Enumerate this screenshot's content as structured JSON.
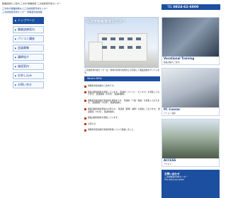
{
  "header": {
    "intro": "職業訓練のご案内 三次市 職業訓練 三次技能者育成センター",
    "link1": "三次市の職業訓練なら三次技能者育成センター",
    "link2": "三次技能者育成センター 求職者支援訓練",
    "tel_label": "TEL",
    "tel_number": "0824-62-6000"
  },
  "sidebar": {
    "items": [
      {
        "label": "トップページ",
        "active": true
      },
      {
        "label": "職業訓練案内",
        "active": false
      },
      {
        "label": "パソコン講座",
        "active": false
      },
      {
        "label": "会員募集",
        "active": false
      },
      {
        "label": "講師紹介",
        "active": false
      },
      {
        "label": "施設案内",
        "active": false
      },
      {
        "label": "お申し込み",
        "active": false
      },
      {
        "label": "お問い合せ",
        "active": false
      }
    ]
  },
  "hero": {
    "caption": "三次技能者育成センター",
    "description": "三次技能者育成センターは、地域の皆様の技能向上を目指して職業訓練を行っています。"
  },
  "news": {
    "heading": "What's NEW",
    "items": [
      {
        "text": "求職者支援訓練のご案内です。"
      },
      {
        "text": "職業訓練受講者を募集しています。 受講者（パソコン・ビジネス）を募集しております。 受講期間（2か月）、受講料無料。"
      },
      {
        "text": "求職者支援訓練の受講者を募集中です。 受講者（介護・福祉）を募集しております。 受講期間（3か月）、受講料無料。"
      },
      {
        "text": "職業訓練受講者募集のお知らせ。 受講者（経理・事務）を募集しております。 受講期間（3か月）、受講料無料。"
      },
      {
        "text": "職業訓練受講者を募集しています。"
      },
      {
        "text": "お知らせ"
      },
      {
        "text": "求職者支援訓練の受講者募集について掲載しました。"
      }
    ]
  },
  "right": {
    "promo1_title": "Vocational Training",
    "promo1_sub": "職業訓練のご案内",
    "promo2_title": "PC Course",
    "promo2_sub": "パソコン講座",
    "promo3_title": "ACCESS",
    "promo3_sub": "アクセス",
    "contact_title": "お問い合わせ",
    "contact_line1": "三次技能者育成センター",
    "contact_line2": "TEL 0824-62-6000"
  }
}
